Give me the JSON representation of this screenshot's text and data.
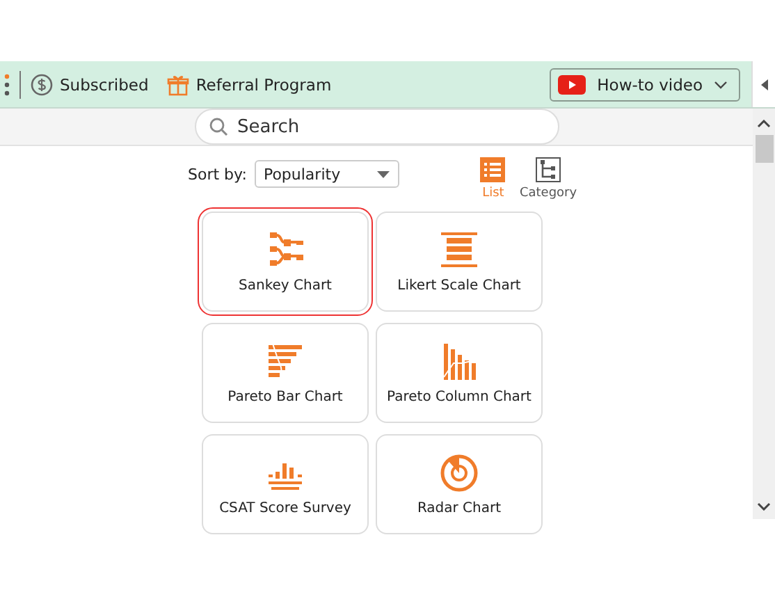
{
  "toolbar": {
    "subscribed": "Subscribed",
    "referral": "Referral Program",
    "video_button": "How-to video"
  },
  "search": {
    "placeholder": "Search"
  },
  "sort": {
    "label": "Sort by:",
    "value": "Popularity"
  },
  "views": [
    {
      "label": "List",
      "kind": "list",
      "selected": true
    },
    {
      "label": "Category",
      "kind": "tree",
      "selected": false
    }
  ],
  "charts": [
    {
      "label": "Sankey Chart",
      "kind": "sankey",
      "selected": true
    },
    {
      "label": "Likert Scale Chart",
      "kind": "likert",
      "selected": false
    },
    {
      "label": "Pareto Bar Chart",
      "kind": "pareto-bar",
      "selected": false
    },
    {
      "label": "Pareto Column Chart",
      "kind": "pareto-column",
      "selected": false
    },
    {
      "label": "CSAT Score Survey",
      "kind": "csat",
      "selected": false
    },
    {
      "label": "Radar Chart",
      "kind": "radar",
      "selected": false
    }
  ]
}
